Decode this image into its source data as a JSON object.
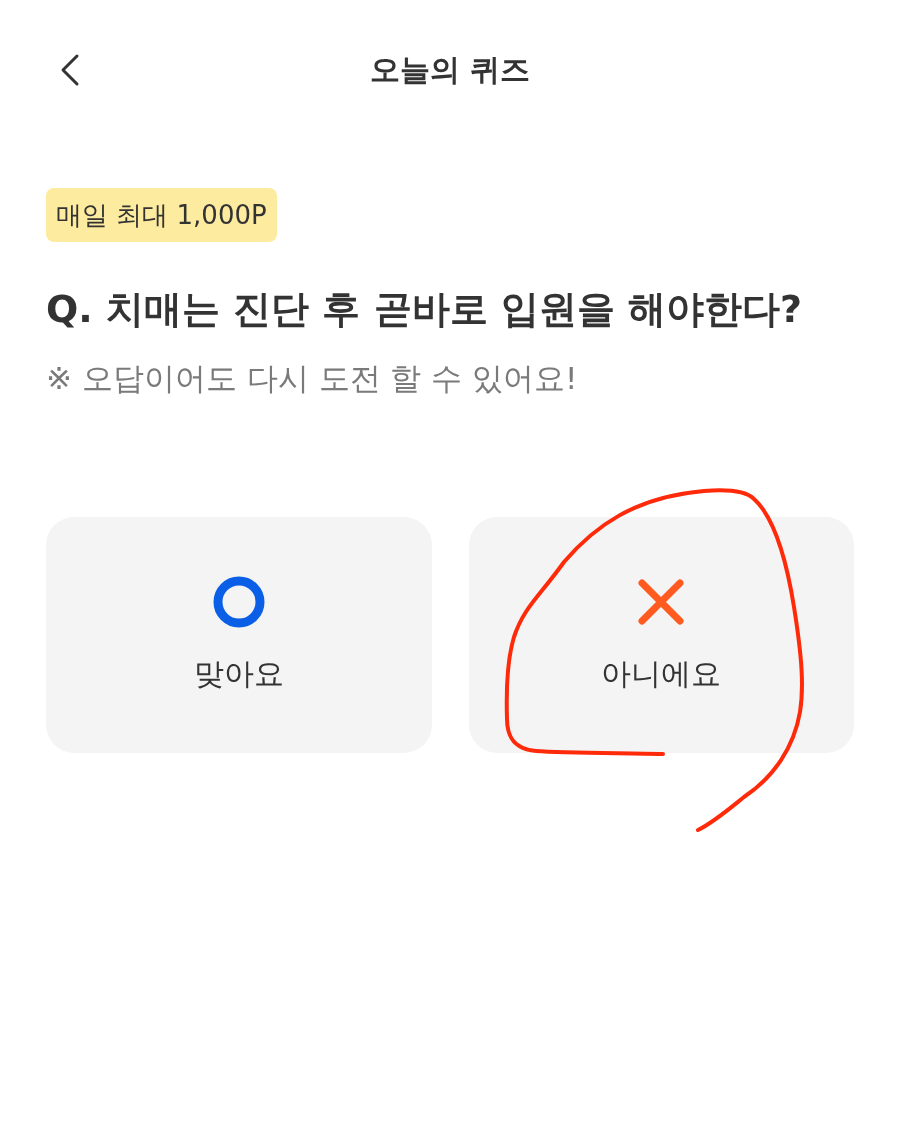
{
  "header": {
    "title": "오늘의 퀴즈"
  },
  "badge": "매일 최대 1,000P",
  "question": "Q. 치매는 진단 후 곧바로 입원을 해야한다?",
  "note": "※ 오답이어도 다시 도전 할 수 있어요!",
  "options": [
    {
      "kind": "o",
      "label": "맞아요",
      "circled": false
    },
    {
      "kind": "x",
      "label": "아니에요",
      "circled": true
    }
  ]
}
